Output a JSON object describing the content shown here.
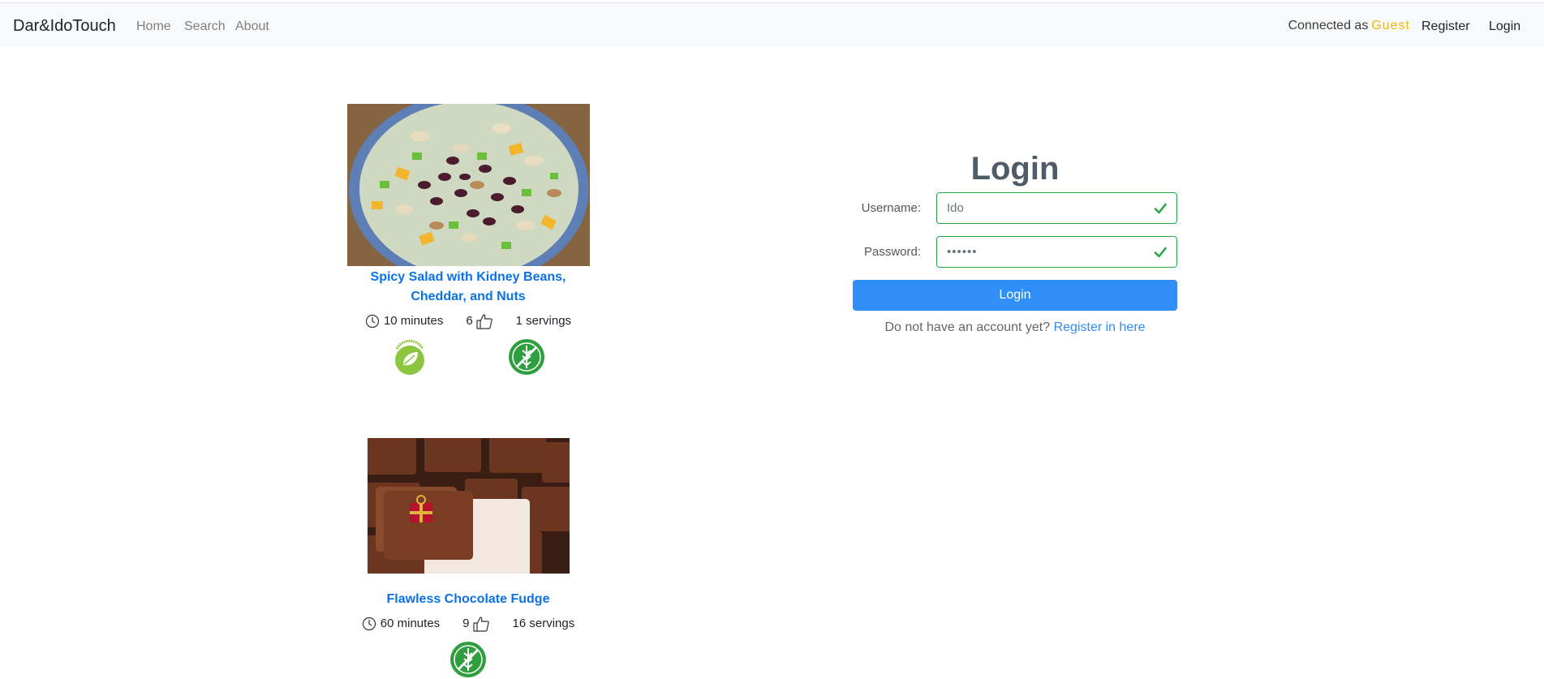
{
  "navbar": {
    "brand": "Dar&IdoTouch",
    "links": [
      "Home",
      "Search",
      "About"
    ],
    "connected_prefix": "Connected as",
    "user": "Guest",
    "register": "Register",
    "login": "Login"
  },
  "recipes": [
    {
      "title": "Spicy Salad with Kidney Beans, Cheddar, and Nuts",
      "time": "10 minutes",
      "likes": "6",
      "servings": "1 servings",
      "badges": [
        "vegetarian-badge",
        "gluten-free-badge"
      ]
    },
    {
      "title": "Flawless Chocolate Fudge",
      "time": "60 minutes",
      "likes": "9",
      "servings": "16 servings",
      "badges": [
        "gluten-free-badge"
      ]
    }
  ],
  "login": {
    "title": "Login",
    "username_label": "Username:",
    "username_value": "Ido",
    "password_label": "Password:",
    "password_value": "••••••",
    "button": "Login",
    "hint": "Do not have an account yet?",
    "register_link": "Register in here"
  },
  "colors": {
    "primary": "#2f8ef7",
    "link": "#0a72e6",
    "valid": "#28a745",
    "guest": "#f0b90b"
  },
  "icons": [
    "clock-icon",
    "thumbs-up-icon",
    "check-icon",
    "vegetarian-icon",
    "gluten-free-icon"
  ]
}
